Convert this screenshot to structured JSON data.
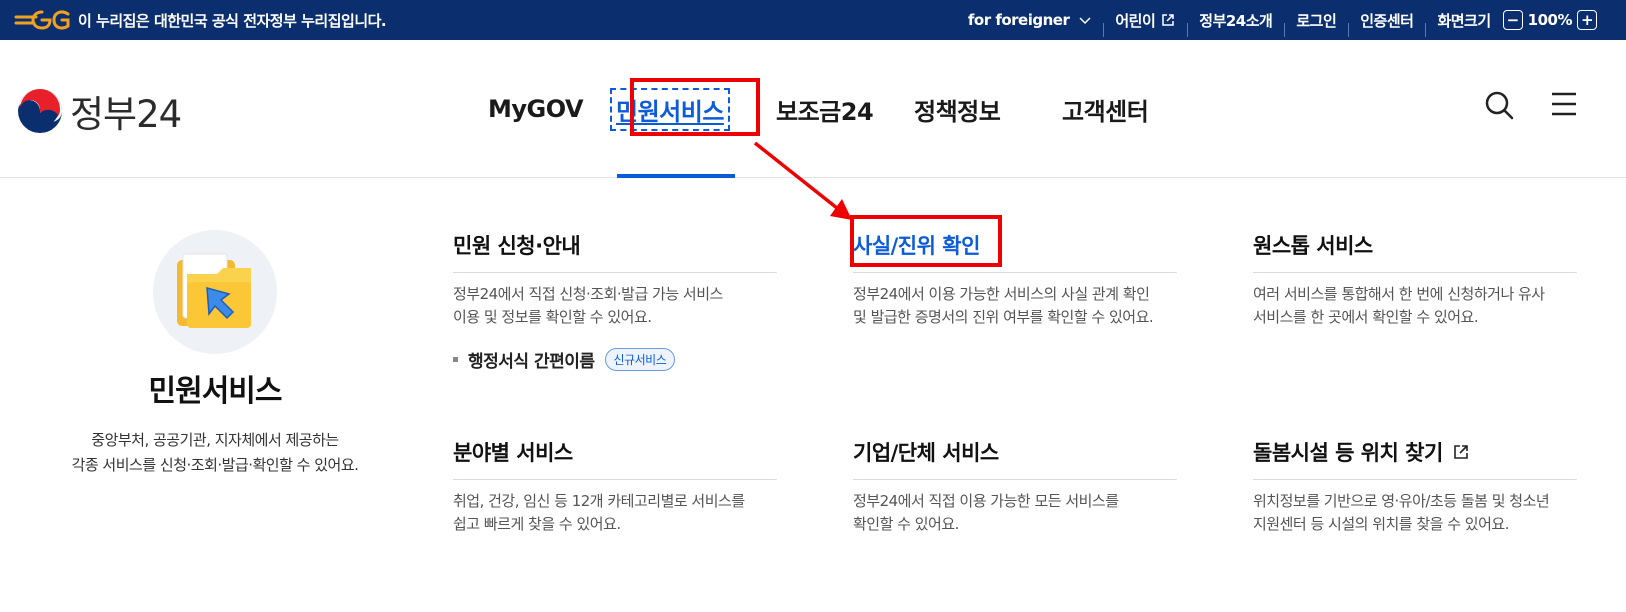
{
  "topbar": {
    "notice": "이 누리집은 대한민국 공식 전자정부 누리집입니다.",
    "links": {
      "foreigner": "for foreigner",
      "kids": "어린이",
      "about": "정부24소개",
      "login": "로그인",
      "cert": "인증센터",
      "screen_size": "화면크기"
    },
    "zoom": {
      "minus": "−",
      "value": "100%",
      "plus": "+"
    }
  },
  "header": {
    "logo_text": "정부24",
    "nav": [
      "MyGOV",
      "민원서비스",
      "보조금24",
      "정책정보",
      "고객센터"
    ],
    "active_nav": "민원서비스"
  },
  "intro": {
    "title": "민원서비스",
    "desc_line1": "중앙부처, 공공기관, 지자체에서 제공하는",
    "desc_line2": "각종 서비스를 신청·조회·발급·확인할 수 있어요."
  },
  "services": {
    "apply": {
      "title": "민원 신청·안내",
      "desc_line1": "정부24에서 직접 신청·조회·발급 가능 서비스",
      "desc_line2": "이용 및 정보를 확인할 수 있어요.",
      "sub_link": "행정서식 간편이름",
      "badge": "신규서비스"
    },
    "verify": {
      "title": "사실/진위 확인",
      "desc_line1": "정부24에서 이용 가능한 서비스의 사실 관계 확인",
      "desc_line2": "및 발급한 증명서의 진위 여부를 확인할 수 있어요."
    },
    "onestop": {
      "title": "원스톱 서비스",
      "desc_line1": "여러 서비스를 통합해서 한 번에 신청하거나 유사",
      "desc_line2": "서비스를 한 곳에서 확인할 수 있어요."
    },
    "field": {
      "title": "분야별 서비스",
      "desc_line1": "취업, 건강, 임신 등 12개 카테고리별로 서비스를",
      "desc_line2": "쉽고 빠르게 찾을 수 있어요."
    },
    "corp": {
      "title": "기업/단체 서비스",
      "desc_line1": "정부24에서 직접 이용 가능한 모든 서비스를",
      "desc_line2": "확인할 수 있어요."
    },
    "care": {
      "title": "돌봄시설 등 위치 찾기",
      "desc_line1": "위치정보를 기반으로 영·유아/초등 돌봄 및 청소년",
      "desc_line2": "지원센터 등 시설의 위치를 찾을 수 있어요."
    }
  },
  "colors": {
    "topbar_bg": "#0b2f6e",
    "accent_blue": "#0c5bd8",
    "annotation_red": "#ee0000"
  }
}
